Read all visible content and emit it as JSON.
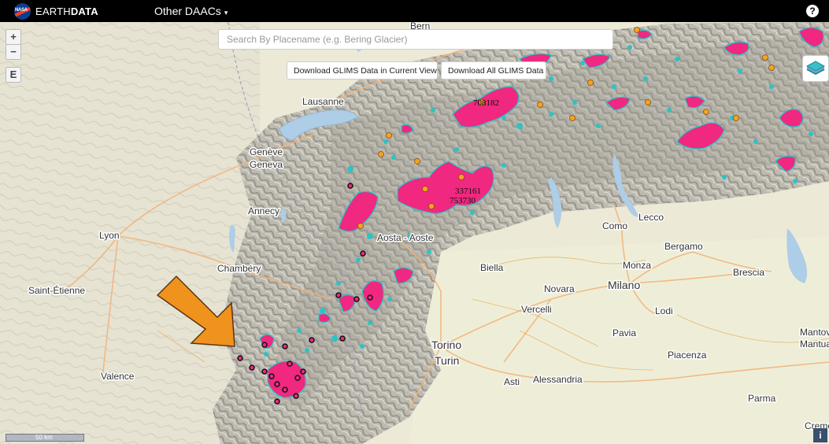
{
  "header": {
    "brand_prefix": "EARTH",
    "brand_bold": "DATA",
    "menu_label": "Other DAACs",
    "menu_caret": "▾",
    "help_label": "?"
  },
  "controls": {
    "zoom_in": "+",
    "zoom_out": "−",
    "e_button": "E",
    "info": "i",
    "scale_label": "50 km"
  },
  "search": {
    "placeholder": "Search By Placename (e.g. Bering Glacier)"
  },
  "buttons": {
    "download_view": "Download GLIMS Data in Current View",
    "download_all": "Download All GLIMS Data"
  },
  "map": {
    "places": [
      {
        "name": "Bern"
      },
      {
        "name": "Lausanne"
      },
      {
        "name": "Genève"
      },
      {
        "name": "Geneva"
      },
      {
        "name": "Annecy"
      },
      {
        "name": "Lyon"
      },
      {
        "name": "Chambéry"
      },
      {
        "name": "Saint-Étienne"
      },
      {
        "name": "Valence"
      },
      {
        "name": "Aosta - Aoste"
      },
      {
        "name": "Biella"
      },
      {
        "name": "Novara"
      },
      {
        "name": "Milano"
      },
      {
        "name": "Como"
      },
      {
        "name": "Lecco"
      },
      {
        "name": "Bergamo"
      },
      {
        "name": "Monza"
      },
      {
        "name": "Brescia"
      },
      {
        "name": "Vercelli"
      },
      {
        "name": "Lodi"
      },
      {
        "name": "Torino"
      },
      {
        "name": "Turin"
      },
      {
        "name": "Pavia"
      },
      {
        "name": "Piacenza"
      },
      {
        "name": "Alessandria"
      },
      {
        "name": "Asti"
      },
      {
        "name": "Parma"
      },
      {
        "name": "Mantova"
      },
      {
        "name": "Mantua"
      },
      {
        "name": "Cremona"
      }
    ],
    "glacier_ids": [
      "708182",
      "337161",
      "753730"
    ],
    "colors": {
      "glacier": "#f0287f",
      "glacier_edge": "#2cc3c6",
      "point": "#f6a41e",
      "arrow": "#f0921e",
      "lake": "#aecde6"
    }
  }
}
